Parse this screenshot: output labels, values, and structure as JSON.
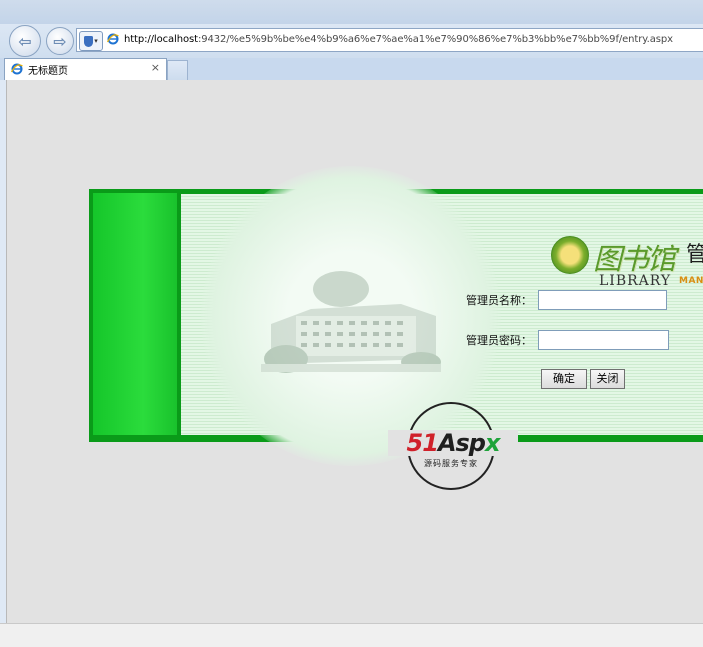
{
  "browser": {
    "url_host": "http://localhost",
    "url_rest": ":9432/%e5%9b%be%e4%b9%a6%e7%ae%a1%e7%90%86%e7%b3%bb%e7%bb%9f/entry.aspx",
    "tab_title": "无标题页",
    "tab_close": "×",
    "back_glyph": "⇦",
    "forward_glyph": "⇨"
  },
  "logo": {
    "calligraphy": "图书馆",
    "title": "管理系统",
    "library": "LIBRARY",
    "manage_system": "MANAGE SYSTEM"
  },
  "form": {
    "name_label": "管理员名称：",
    "name_value": "",
    "password_label": "管理员密码：",
    "password_value": "",
    "confirm_button": "确定",
    "close_button": "关闭"
  },
  "watermark": {
    "brand_51": "51",
    "brand_asp": "Asp",
    "brand_x": "x",
    "tagline": "源码服务专家"
  },
  "colors": {
    "banner_green": "#0a9b19",
    "side_green": "#2bdc3c",
    "page_bg": "#e2e2e2"
  }
}
